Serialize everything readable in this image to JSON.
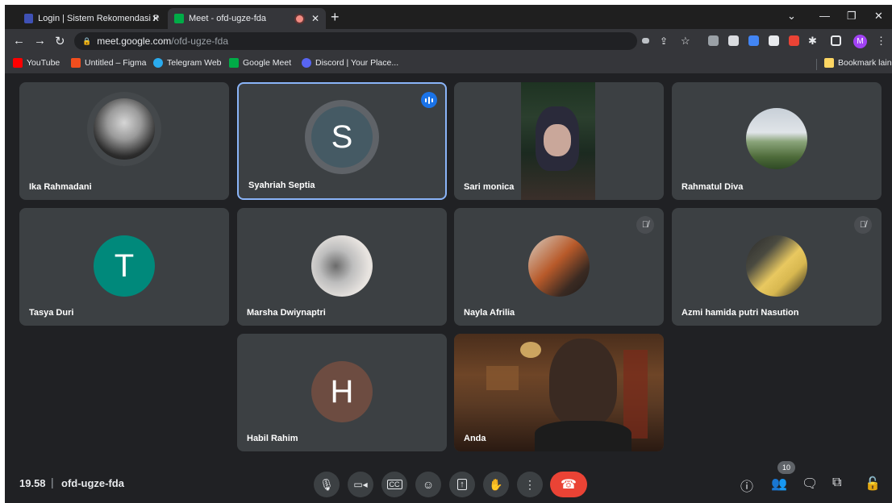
{
  "browser": {
    "tabs": [
      {
        "title": "Login | Sistem Rekomendasi Pen"
      },
      {
        "title": "Meet - ofd-ugze-fda"
      }
    ],
    "url_host": "meet.google.com",
    "url_path": "/ofd-ugze-fda",
    "profile_initial": "M",
    "bookmarks": [
      {
        "label": "YouTube",
        "color": "#ff0000"
      },
      {
        "label": "Untitled – Figma",
        "color": "#f24e1e"
      },
      {
        "label": "Telegram Web",
        "color": "#2aabee"
      },
      {
        "label": "Google Meet",
        "color": "#00ac47"
      },
      {
        "label": "Discord | Your Place...",
        "color": "#5865f2"
      }
    ],
    "other_bookmarks": "Bookmark lain"
  },
  "participants": [
    {
      "name": "Ika Rahmadani",
      "kind": "photo"
    },
    {
      "name": "Syahriah Septia",
      "kind": "letter",
      "initial": "S",
      "speaking": true
    },
    {
      "name": "Sari monica",
      "kind": "video"
    },
    {
      "name": "Rahmatul Diva",
      "kind": "photo"
    },
    {
      "name": "Tasya Duri",
      "kind": "letter",
      "initial": "T"
    },
    {
      "name": "Marsha Dwiynaptri",
      "kind": "photo"
    },
    {
      "name": "Nayla Afrilia",
      "kind": "photo",
      "muted": true
    },
    {
      "name": "Azmi hamida putri Nasution",
      "kind": "photo",
      "muted": true
    },
    {
      "name": "Habil Rahim",
      "kind": "letter",
      "initial": "H"
    },
    {
      "name": "Anda",
      "kind": "video"
    }
  ],
  "bottom_bar": {
    "time": "19.58",
    "separator": "|",
    "meeting_code": "ofd-ugze-fda",
    "participant_count": "10"
  },
  "colors": {
    "meet_background": "#202124",
    "tile": "#3c4043",
    "end_call": "#ea4335",
    "active_speaker": "#8ab4f8",
    "avatar_s": "#455a64",
    "avatar_t": "#00897b",
    "avatar_h": "#6d4c41"
  }
}
